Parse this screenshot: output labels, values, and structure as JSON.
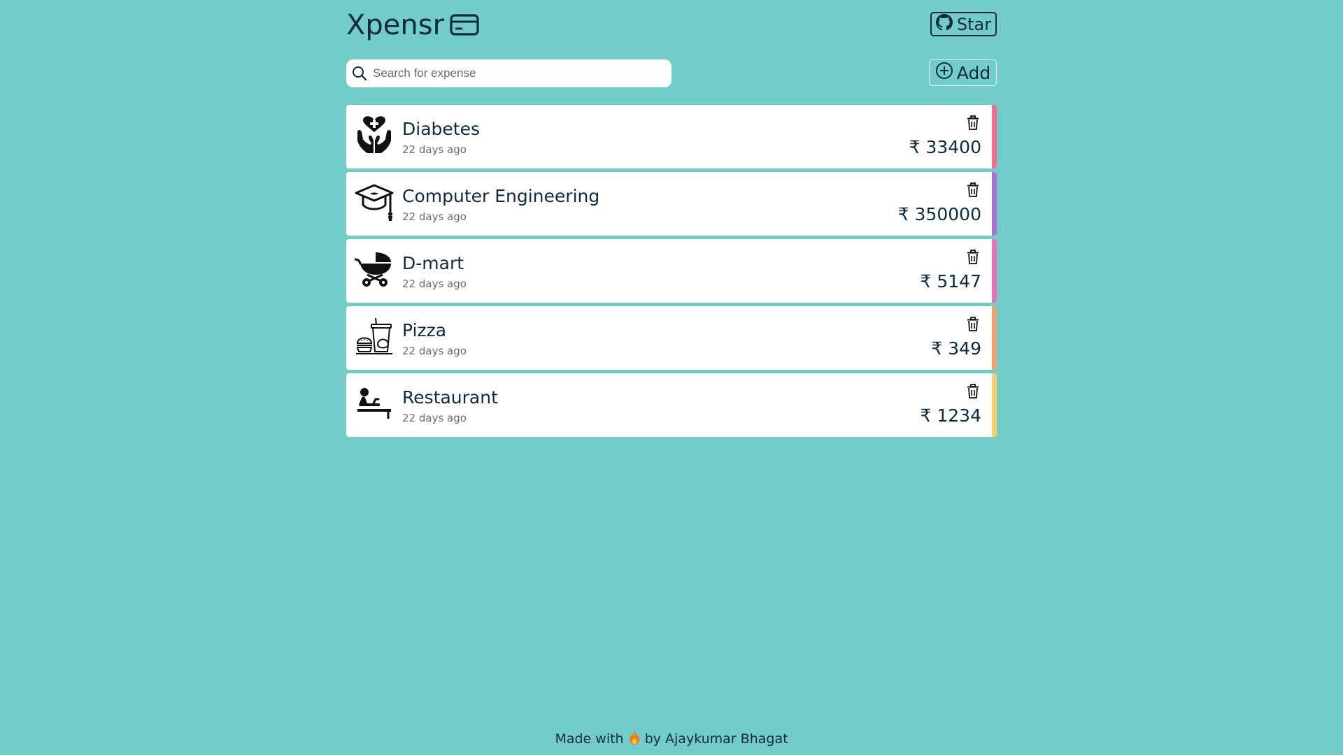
{
  "header": {
    "title": "Xpensr",
    "logo_icon": "credit-card-icon",
    "star_label": "Star",
    "star_icon": "github-icon"
  },
  "toolbar": {
    "search_placeholder": "Search for expense",
    "search_value": "",
    "add_label": "Add",
    "add_icon": "plus-circle-icon"
  },
  "expenses": [
    {
      "name": "Diabetes",
      "time": "22 days ago",
      "amount": "₹ 33400",
      "icon": "health-care-icon",
      "color": "#f06e8c"
    },
    {
      "name": "Computer Engineering",
      "time": "22 days ago",
      "amount": "₹ 350000",
      "icon": "graduation-cap-icon",
      "color": "#b06fd6"
    },
    {
      "name": "D-mart",
      "time": "22 days ago",
      "amount": "₹ 5147",
      "icon": "baby-stroller-icon",
      "color": "#ec6fb8"
    },
    {
      "name": "Pizza",
      "time": "22 days ago",
      "amount": "₹ 349",
      "icon": "fast-food-icon",
      "color": "#f4a36c"
    },
    {
      "name": "Restaurant",
      "time": "22 days ago",
      "amount": "₹ 1234",
      "icon": "massage-icon",
      "color": "#f9d06a"
    }
  ],
  "footer": {
    "prefix": "Made with",
    "suffix": "by Ajaykumar Bhagat",
    "icon": "fire-icon"
  }
}
